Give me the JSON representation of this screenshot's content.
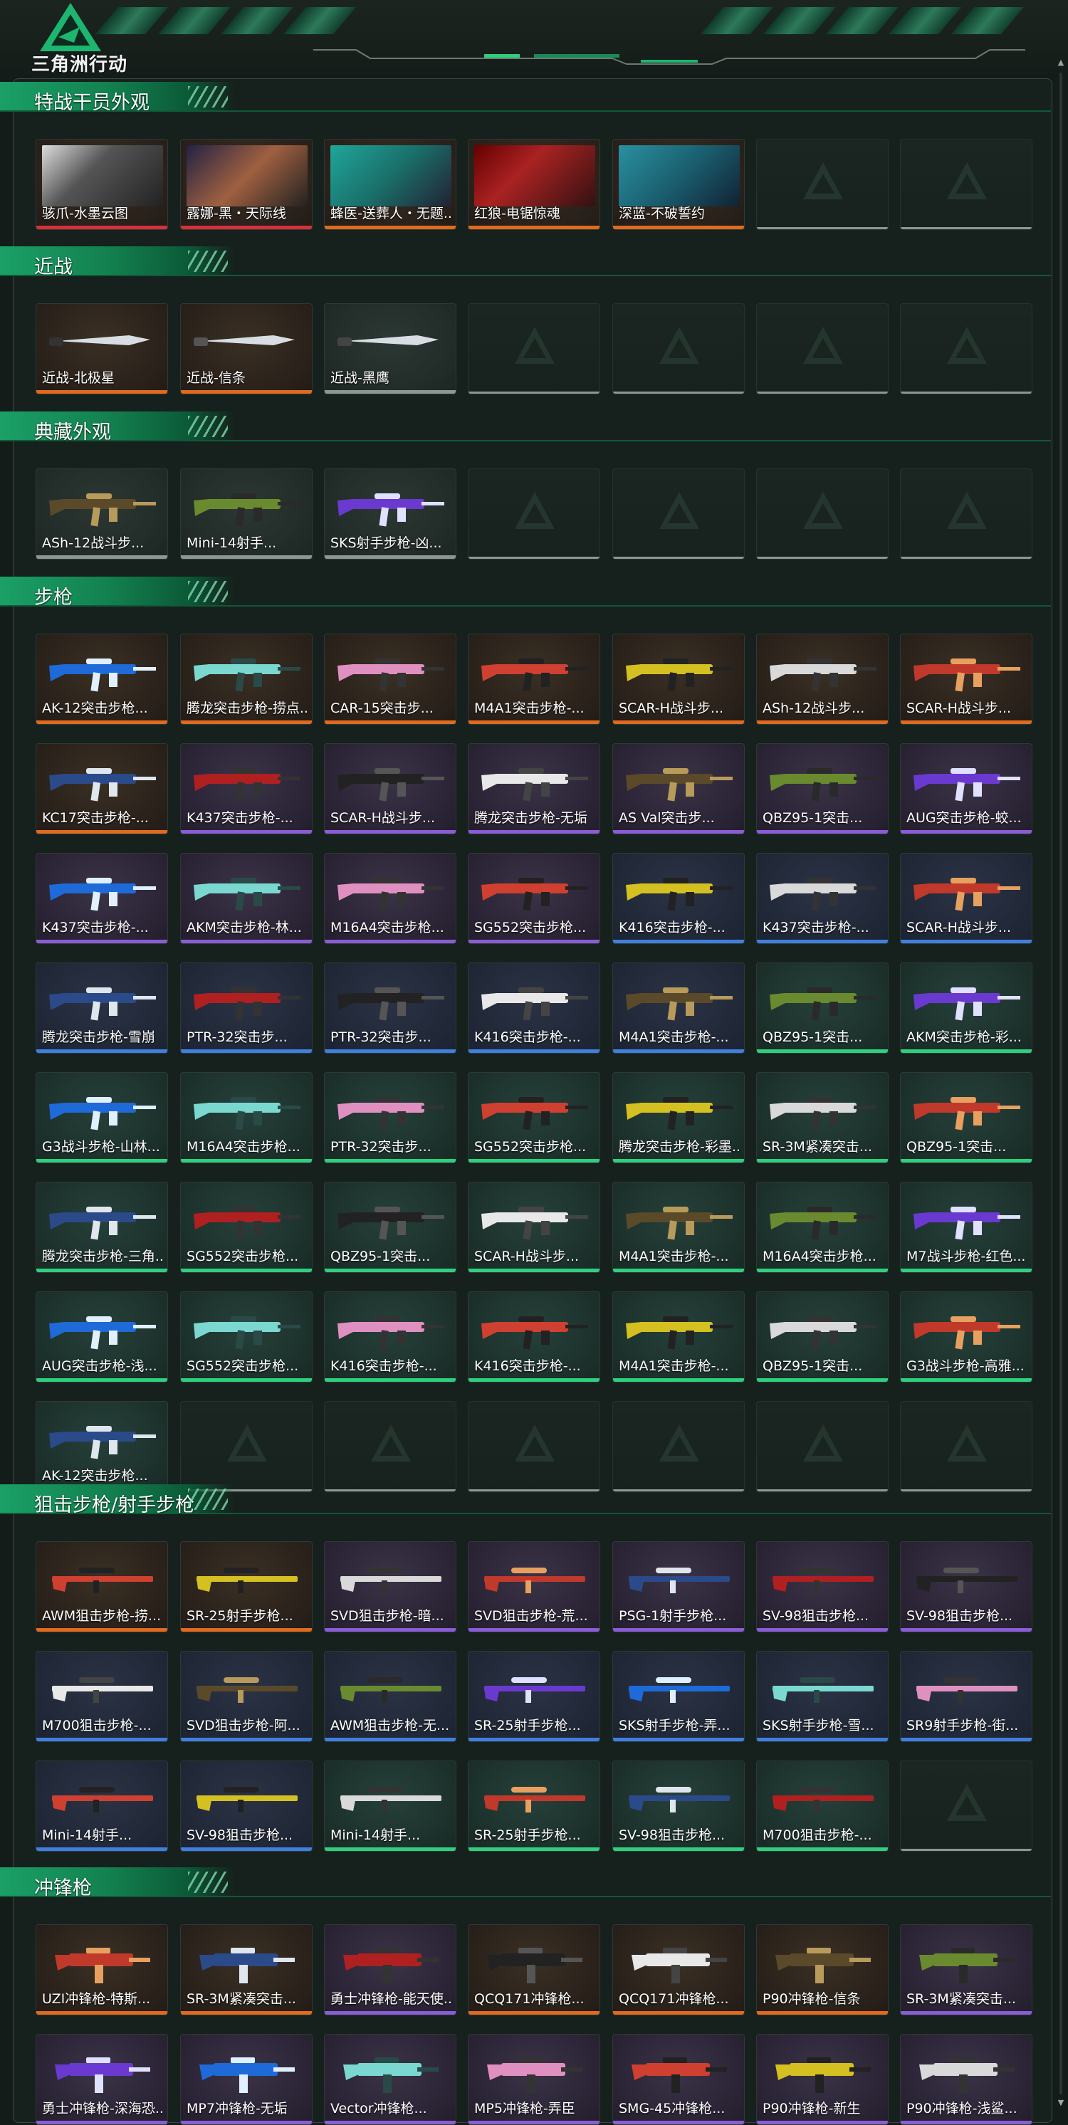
{
  "app": {
    "title": "三角洲行动"
  },
  "colors": {
    "orange": "#e06a1f",
    "purple": "#8a5cd6",
    "blue": "#3f7fe0",
    "green": "#2fcf7e",
    "gray": "#8d9792",
    "accent": "#13a060"
  },
  "sections": [
    {
      "title": "特战干员外观",
      "items": [
        {
          "name": "骇爪-水墨云图",
          "q": "red",
          "icon": "operator-portrait-icon"
        },
        {
          "name": "露娜-黑・天际线",
          "q": "red",
          "icon": "operator-portrait-icon"
        },
        {
          "name": "蜂医-送葬人・无题...",
          "q": "orange",
          "icon": "operator-portrait-icon"
        },
        {
          "name": "红狼-电锯惊魂",
          "q": "orange",
          "icon": "operator-portrait-icon"
        },
        {
          "name": "深蓝-不破誓约",
          "q": "orange",
          "icon": "operator-portrait-icon"
        },
        null,
        null
      ]
    },
    {
      "title": "近战",
      "items": [
        {
          "name": "近战-北极星",
          "q": "orange",
          "icon": "knife-icon"
        },
        {
          "name": "近战-信条",
          "q": "orange",
          "icon": "knife-icon"
        },
        {
          "name": "近战-黑鹰",
          "q": "gray",
          "icon": "knife-icon"
        },
        null,
        null,
        null,
        null
      ]
    },
    {
      "title": "典藏外观",
      "items": [
        {
          "name": "ASh-12战斗步...",
          "q": "gray",
          "icon": "rifle-icon"
        },
        {
          "name": "Mini-14射手...",
          "q": "gray",
          "icon": "rifle-icon"
        },
        {
          "name": "SKS射手步枪-凶...",
          "q": "gray",
          "icon": "rifle-icon"
        },
        null,
        null,
        null,
        null
      ]
    },
    {
      "title": "步枪",
      "items": [
        {
          "name": "AK-12突击步枪...",
          "q": "orange",
          "icon": "rifle-icon"
        },
        {
          "name": "腾龙突击步枪-捞点...",
          "q": "orange",
          "icon": "rifle-icon"
        },
        {
          "name": "CAR-15突击步...",
          "q": "orange",
          "icon": "rifle-icon"
        },
        {
          "name": "M4A1突击步枪-...",
          "q": "orange",
          "icon": "rifle-icon"
        },
        {
          "name": "SCAR-H战斗步...",
          "q": "orange",
          "icon": "rifle-icon"
        },
        {
          "name": "ASh-12战斗步...",
          "q": "orange",
          "icon": "rifle-icon"
        },
        {
          "name": "SCAR-H战斗步...",
          "q": "orange",
          "icon": "rifle-icon"
        },
        {
          "name": "KC17突击步枪-...",
          "q": "orange",
          "icon": "rifle-icon"
        },
        {
          "name": "K437突击步枪-...",
          "q": "purple",
          "icon": "rifle-icon"
        },
        {
          "name": "SCAR-H战斗步...",
          "q": "purple",
          "icon": "rifle-icon"
        },
        {
          "name": "腾龙突击步枪-无垢",
          "q": "purple",
          "icon": "rifle-icon"
        },
        {
          "name": "AS Val突击步...",
          "q": "purple",
          "icon": "rifle-icon"
        },
        {
          "name": "QBZ95-1突击...",
          "q": "purple",
          "icon": "rifle-icon"
        },
        {
          "name": "AUG突击步枪-蛟...",
          "q": "purple",
          "icon": "rifle-icon"
        },
        {
          "name": "K437突击步枪-...",
          "q": "purple",
          "icon": "rifle-icon"
        },
        {
          "name": "AKM突击步枪-林...",
          "q": "purple",
          "icon": "rifle-icon"
        },
        {
          "name": "M16A4突击步枪...",
          "q": "purple",
          "icon": "rifle-icon"
        },
        {
          "name": "SG552突击步枪...",
          "q": "purple",
          "icon": "rifle-icon"
        },
        {
          "name": "K416突击步枪-...",
          "q": "blue",
          "icon": "rifle-icon"
        },
        {
          "name": "K437突击步枪-...",
          "q": "blue",
          "icon": "rifle-icon"
        },
        {
          "name": "SCAR-H战斗步...",
          "q": "blue",
          "icon": "rifle-icon"
        },
        {
          "name": "腾龙突击步枪-雪崩",
          "q": "blue",
          "icon": "rifle-icon"
        },
        {
          "name": "PTR-32突击步...",
          "q": "blue",
          "icon": "rifle-icon"
        },
        {
          "name": "PTR-32突击步...",
          "q": "blue",
          "icon": "rifle-icon"
        },
        {
          "name": "K416突击步枪-...",
          "q": "blue",
          "icon": "rifle-icon"
        },
        {
          "name": "M4A1突击步枪-...",
          "q": "blue",
          "icon": "rifle-icon"
        },
        {
          "name": "QBZ95-1突击...",
          "q": "green",
          "icon": "rifle-icon"
        },
        {
          "name": "AKM突击步枪-彩...",
          "q": "green",
          "icon": "rifle-icon"
        },
        {
          "name": "G3战斗步枪-山林...",
          "q": "green",
          "icon": "rifle-icon"
        },
        {
          "name": "M16A4突击步枪...",
          "q": "green",
          "icon": "rifle-icon"
        },
        {
          "name": "PTR-32突击步...",
          "q": "green",
          "icon": "rifle-icon"
        },
        {
          "name": "SG552突击步枪...",
          "q": "green",
          "icon": "rifle-icon"
        },
        {
          "name": "腾龙突击步枪-彩墨...",
          "q": "green",
          "icon": "rifle-icon"
        },
        {
          "name": "SR-3M紧凑突击...",
          "q": "green",
          "icon": "rifle-icon"
        },
        {
          "name": "QBZ95-1突击...",
          "q": "green",
          "icon": "rifle-icon"
        },
        {
          "name": "腾龙突击步枪-三角...",
          "q": "green",
          "icon": "rifle-icon"
        },
        {
          "name": "SG552突击步枪...",
          "q": "green",
          "icon": "rifle-icon"
        },
        {
          "name": "QBZ95-1突击...",
          "q": "green",
          "icon": "rifle-icon"
        },
        {
          "name": "SCAR-H战斗步...",
          "q": "green",
          "icon": "rifle-icon"
        },
        {
          "name": "M4A1突击步枪-...",
          "q": "green",
          "icon": "rifle-icon"
        },
        {
          "name": "M16A4突击步枪...",
          "q": "green",
          "icon": "rifle-icon"
        },
        {
          "name": "M7战斗步枪-红色...",
          "q": "green",
          "icon": "rifle-icon"
        },
        {
          "name": "AUG突击步枪-浅...",
          "q": "green",
          "icon": "rifle-icon"
        },
        {
          "name": "SG552突击步枪...",
          "q": "green",
          "icon": "rifle-icon"
        },
        {
          "name": "K416突击步枪-...",
          "q": "green",
          "icon": "rifle-icon"
        },
        {
          "name": "K416突击步枪-...",
          "q": "green",
          "icon": "rifle-icon"
        },
        {
          "name": "M4A1突击步枪-...",
          "q": "green",
          "icon": "rifle-icon"
        },
        {
          "name": "QBZ95-1突击...",
          "q": "green",
          "icon": "rifle-icon"
        },
        {
          "name": "G3战斗步枪-高雅...",
          "q": "green",
          "icon": "rifle-icon"
        },
        {
          "name": "AK-12突击步枪...",
          "q": "green",
          "icon": "rifle-icon"
        },
        null,
        null,
        null,
        null,
        null,
        null
      ]
    },
    {
      "title": "狙击步枪/射手步枪",
      "items": [
        {
          "name": "AWM狙击步枪-捞...",
          "q": "orange",
          "icon": "sniper-rifle-icon"
        },
        {
          "name": "SR-25射手步枪...",
          "q": "orange",
          "icon": "sniper-rifle-icon"
        },
        {
          "name": "SVD狙击步枪-暗...",
          "q": "purple",
          "icon": "sniper-rifle-icon"
        },
        {
          "name": "SVD狙击步枪-荒...",
          "q": "purple",
          "icon": "sniper-rifle-icon"
        },
        {
          "name": "PSG-1射手步枪...",
          "q": "purple",
          "icon": "sniper-rifle-icon"
        },
        {
          "name": "SV-98狙击步枪...",
          "q": "purple",
          "icon": "sniper-rifle-icon"
        },
        {
          "name": "SV-98狙击步枪...",
          "q": "purple",
          "icon": "sniper-rifle-icon"
        },
        {
          "name": "M700狙击步枪-...",
          "q": "blue",
          "icon": "sniper-rifle-icon"
        },
        {
          "name": "SVD狙击步枪-阿...",
          "q": "blue",
          "icon": "sniper-rifle-icon"
        },
        {
          "name": "AWM狙击步枪-无...",
          "q": "blue",
          "icon": "sniper-rifle-icon"
        },
        {
          "name": "SR-25射手步枪...",
          "q": "blue",
          "icon": "sniper-rifle-icon"
        },
        {
          "name": "SKS射手步枪-弄...",
          "q": "blue",
          "icon": "sniper-rifle-icon"
        },
        {
          "name": "SKS射手步枪-雪...",
          "q": "blue",
          "icon": "sniper-rifle-icon"
        },
        {
          "name": "SR9射手步枪-街...",
          "q": "blue",
          "icon": "sniper-rifle-icon"
        },
        {
          "name": "Mini-14射手...",
          "q": "blue",
          "icon": "sniper-rifle-icon"
        },
        {
          "name": "SV-98狙击步枪...",
          "q": "blue",
          "icon": "sniper-rifle-icon"
        },
        {
          "name": "Mini-14射手...",
          "q": "green",
          "icon": "sniper-rifle-icon"
        },
        {
          "name": "SR-25射手步枪...",
          "q": "green",
          "icon": "sniper-rifle-icon"
        },
        {
          "name": "SV-98狙击步枪...",
          "q": "green",
          "icon": "sniper-rifle-icon"
        },
        {
          "name": "M700狙击步枪-...",
          "q": "green",
          "icon": "sniper-rifle-icon"
        },
        null
      ]
    },
    {
      "title": "冲锋枪",
      "items": [
        {
          "name": "UZI冲锋枪-特斯...",
          "q": "orange",
          "icon": "smg-icon"
        },
        {
          "name": "SR-3M紧凑突击...",
          "q": "orange",
          "icon": "smg-icon"
        },
        {
          "name": "勇士冲锋枪-能天使...",
          "q": "purple",
          "icon": "smg-icon"
        },
        {
          "name": "QCQ171冲锋枪...",
          "q": "orange",
          "icon": "smg-icon"
        },
        {
          "name": "QCQ171冲锋枪...",
          "q": "orange",
          "icon": "smg-icon"
        },
        {
          "name": "P90冲锋枪-信条",
          "q": "orange",
          "icon": "smg-icon"
        },
        {
          "name": "SR-3M紧凑突击...",
          "q": "purple",
          "icon": "smg-icon"
        },
        {
          "name": "勇士冲锋枪-深海恐...",
          "q": "purple",
          "icon": "smg-icon"
        },
        {
          "name": "MP7冲锋枪-无垢",
          "q": "purple",
          "icon": "smg-icon"
        },
        {
          "name": "Vector冲锋枪...",
          "q": "purple",
          "icon": "smg-icon"
        },
        {
          "name": "MP5冲锋枪-弄臣",
          "q": "purple",
          "icon": "smg-icon"
        },
        {
          "name": "SMG-45冲锋枪...",
          "q": "purple",
          "icon": "smg-icon"
        },
        {
          "name": "P90冲锋枪-新生",
          "q": "purple",
          "icon": "smg-icon"
        },
        {
          "name": "P90冲锋枪-浅鲨...",
          "q": "purple",
          "icon": "smg-icon"
        }
      ]
    }
  ]
}
